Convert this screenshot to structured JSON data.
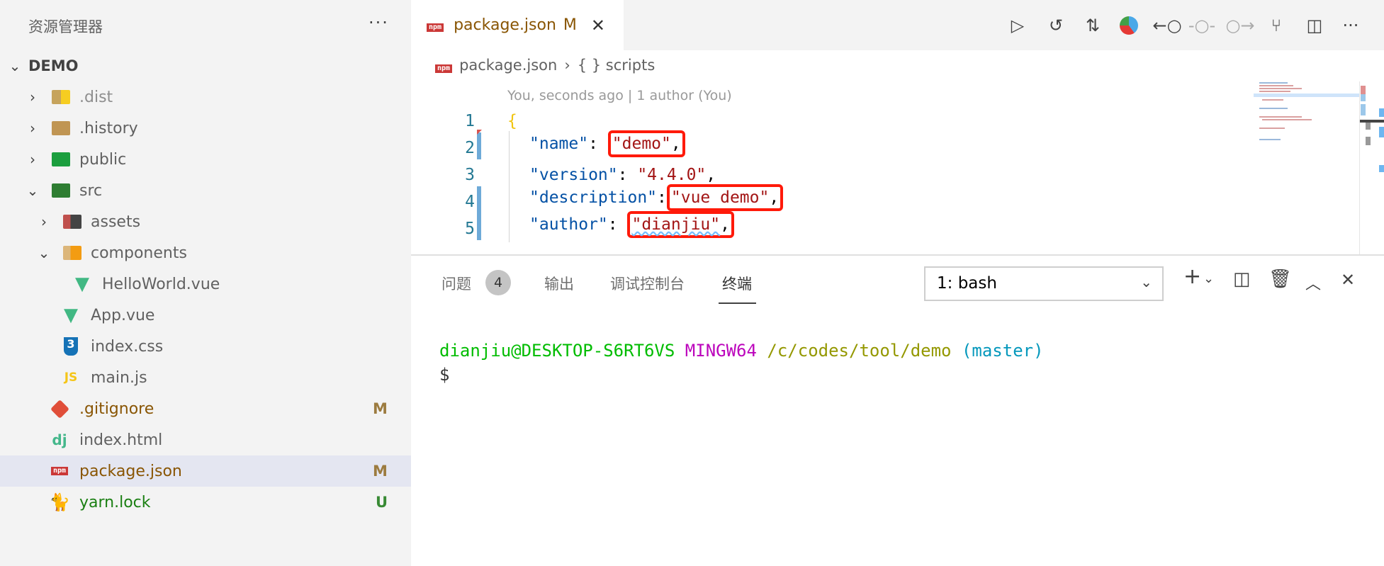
{
  "sidebar": {
    "title": "资源管理器",
    "more": "···",
    "root": "DEMO",
    "items": [
      {
        "label": ".dist",
        "icon": "folder-dist-icon",
        "expanded": false
      },
      {
        "label": ".history",
        "icon": "folder-icon",
        "expanded": false
      },
      {
        "label": "public",
        "icon": "folder-public-icon",
        "expanded": false
      },
      {
        "label": "src",
        "icon": "folder-src-icon",
        "expanded": true
      },
      {
        "label": "assets",
        "icon": "folder-assets-icon",
        "expanded": false
      },
      {
        "label": "components",
        "icon": "folder-components-icon",
        "expanded": true
      },
      {
        "label": "HelloWorld.vue",
        "icon": "vue-icon"
      },
      {
        "label": "App.vue",
        "icon": "vue-icon"
      },
      {
        "label": "index.css",
        "icon": "css3-icon"
      },
      {
        "label": "main.js",
        "icon": "js-icon",
        "icon_text": "JS"
      },
      {
        "label": ".gitignore",
        "icon": "git-icon",
        "badge": "M"
      },
      {
        "label": "index.html",
        "icon": "django-icon",
        "icon_text": "dj"
      },
      {
        "label": "package.json",
        "icon": "npm-icon",
        "icon_text": "npm",
        "badge": "M",
        "selected": true
      },
      {
        "label": "yarn.lock",
        "icon": "yarn-icon",
        "badge": "U"
      }
    ]
  },
  "editor": {
    "tab": {
      "label": "package.json",
      "status": "M",
      "icon_text": "npm"
    },
    "breadcrumb": [
      "package.json",
      "{ } scripts"
    ],
    "codelens": "You, seconds ago | 1 author (You)",
    "lines": [
      {
        "n": "1",
        "brace": "{"
      },
      {
        "n": "2",
        "key": "\"name\"",
        "val": "\"demo\"",
        "boxed": true
      },
      {
        "n": "3",
        "key": "\"version\"",
        "val": "\"4.4.0\"",
        "boxed": false
      },
      {
        "n": "4",
        "key": "\"description\"",
        "val": "\"vue demo\"",
        "boxed": true
      },
      {
        "n": "5",
        "key": "\"author\"",
        "val": "\"dianjiu\"",
        "boxed": true
      }
    ],
    "toolbar": [
      "run-icon",
      "timeline-icon",
      "compare-changes-icon",
      "pie-chart-icon",
      "git-previous-icon",
      "git-commit-icon",
      "git-next-icon",
      "git-graph-icon",
      "split-editor-icon",
      "more-icon"
    ],
    "highlight_color": "#ff1a0a"
  },
  "panel": {
    "tabs": [
      "问题",
      "输出",
      "调试控制台",
      "终端"
    ],
    "problems_count": "4",
    "active_tab": "终端",
    "terminal_select": "1: bash",
    "terminal": {
      "user": "dianjiu@DESKTOP-S6RT6VS",
      "env": "MINGW64",
      "path": "/c/codes/tool/demo",
      "branch": "(master)",
      "prompt": "$"
    }
  }
}
